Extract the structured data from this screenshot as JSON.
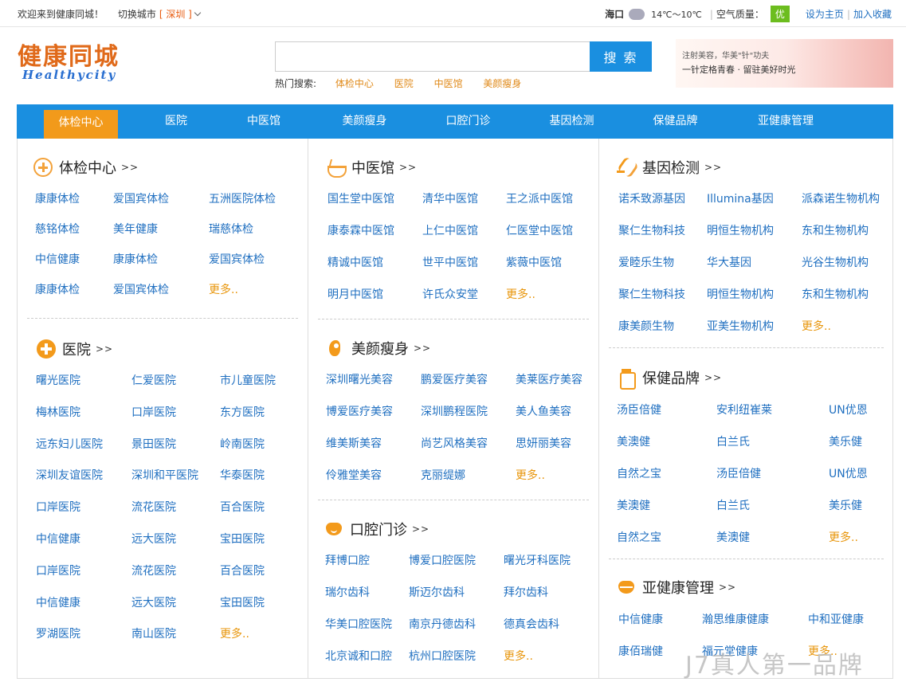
{
  "topbar": {
    "welcome": "欢迎来到健康同城！",
    "switch_city": "切换城市",
    "city": "[ 深圳 ]",
    "weather_city": "海口",
    "temp": "14℃～10℃",
    "air_label": "空气质量：",
    "air_value": "优",
    "set_home": "设为主页",
    "favorite": "加入收藏"
  },
  "logo": {
    "cn": "健康同城",
    "en": "Healthycity"
  },
  "search": {
    "placeholder": "",
    "button": "搜 索",
    "hot_label": "热门搜索:",
    "hot": [
      "体检中心",
      "医院",
      "中医馆",
      "美颜瘦身"
    ]
  },
  "banner": {
    "line1": "注射美容，华美\"针\"功夫",
    "line2": "一针定格青春 · 留驻美好时光"
  },
  "nav": [
    "体检中心",
    "医院",
    "中医馆",
    "美颜瘦身",
    "口腔门诊",
    "基因检测",
    "保健品牌",
    "亚健康管理"
  ],
  "sections": {
    "tijian": {
      "title": "体检中心",
      "arrow": ">>",
      "items": [
        "康康体检",
        "爱国宾体检",
        "五洲医院体检",
        "慈铭体检",
        "美年健康",
        "瑞慈体检",
        "中信健康",
        "康康体检",
        "爱国宾体检",
        "康康体检",
        "爱国宾体检",
        "更多.."
      ]
    },
    "yiyuan": {
      "title": "医院",
      "arrow": ">>",
      "items": [
        "曙光医院",
        "仁爱医院",
        "市儿童医院",
        "梅林医院",
        "口岸医院",
        "东方医院",
        "远东妇儿医院",
        "景田医院",
        "岭南医院",
        "深圳友谊医院",
        "深圳和平医院",
        "华泰医院",
        "口岸医院",
        "流花医院",
        "百合医院",
        "中信健康",
        "远大医院",
        "宝田医院",
        "口岸医院",
        "流花医院",
        "百合医院",
        "中信健康",
        "远大医院",
        "宝田医院",
        "罗湖医院",
        "南山医院",
        "更多.."
      ]
    },
    "zhongyi": {
      "title": "中医馆",
      "arrow": ">>",
      "items": [
        "国生堂中医馆",
        "清华中医馆",
        "王之派中医馆",
        "康泰霖中医馆",
        "上仁中医馆",
        "仁医堂中医馆",
        "精诚中医馆",
        "世平中医馆",
        "紫薇中医馆",
        "明月中医馆",
        "许氏众安堂",
        "更多.."
      ]
    },
    "meiyan": {
      "title": "美颜瘦身",
      "arrow": ">>",
      "items": [
        "深圳曙光美容",
        "鹏爱医疗美容",
        "美莱医疗美容",
        "博爱医疗美容",
        "深圳鹏程医院",
        "美人鱼美容",
        "维美斯美容",
        "尚艺风格美容",
        "思妍丽美容",
        "伶雅堂美容",
        "克丽缇娜",
        "更多.."
      ]
    },
    "kouqiang": {
      "title": "口腔门诊",
      "arrow": ">>",
      "items": [
        "拜博口腔",
        "博爱口腔医院",
        "曙光牙科医院",
        "瑞尔齿科",
        "斯迈尔齿科",
        "拜尔齿科",
        "华美口腔医院",
        "南京丹德齿科",
        "德真会齿科",
        "北京诚和口腔",
        "杭州口腔医院",
        "更多.."
      ]
    },
    "jiyin": {
      "title": "基因检测",
      "arrow": ">>",
      "items": [
        "诺禾致源基因",
        "Illumina基因",
        "派森诺生物机构",
        "聚仁生物科技",
        "明恒生物机构",
        "东和生物机构",
        "爱睦乐生物",
        "华大基因",
        "光谷生物机构",
        "聚仁生物科技",
        "明恒生物机构",
        "东和生物机构",
        "康美颜生物",
        "亚美生物机构",
        "更多.."
      ]
    },
    "baojian": {
      "title": "保健品牌",
      "arrow": ">>",
      "items": [
        "汤臣倍健",
        "安利纽崔莱",
        "UN优恩",
        "美澳健",
        "白兰氏",
        "美乐健",
        "自然之宝",
        "汤臣倍健",
        "UN优恩",
        "美澳健",
        "白兰氏",
        "美乐健",
        "自然之宝",
        "美澳健",
        "更多.."
      ]
    },
    "yajiankang": {
      "title": "亚健康管理",
      "arrow": ">>",
      "items": [
        "中信健康",
        "瀚思维康健康",
        "中和亚健康",
        "康佰瑞健",
        "福元堂健康",
        "更多.."
      ]
    }
  },
  "watermark": "J7真人第一品牌"
}
